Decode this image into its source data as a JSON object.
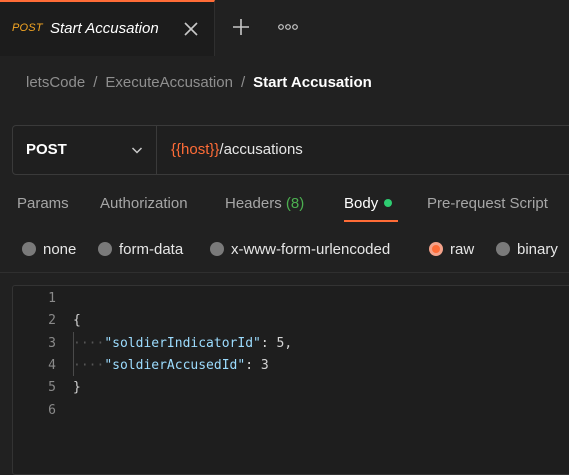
{
  "tab": {
    "method": "POST",
    "name": "Start Accusation"
  },
  "breadcrumb": {
    "items": [
      "letsCode",
      "ExecuteAccusation"
    ],
    "separator": "/",
    "current": "Start Accusation"
  },
  "request": {
    "method": "POST",
    "url_var": "{{host}}",
    "url_path": "/accusations"
  },
  "request_tabs": [
    {
      "label": "Params"
    },
    {
      "label": "Authorization"
    },
    {
      "label": "Headers",
      "count": "(8)"
    },
    {
      "label": "Body",
      "active": true
    },
    {
      "label": "Pre-request Script"
    }
  ],
  "body_types": [
    {
      "label": "none",
      "selected": false
    },
    {
      "label": "form-data",
      "selected": false
    },
    {
      "label": "x-www-form-urlencoded",
      "selected": false
    },
    {
      "label": "raw",
      "selected": true
    },
    {
      "label": "binary",
      "selected": false
    }
  ],
  "editor": {
    "line_numbers": [
      "1",
      "2",
      "3",
      "4",
      "5",
      "6"
    ],
    "open_brace": "{",
    "close_brace": "}",
    "indent_dots": "····",
    "fields": [
      {
        "key": "\"soldierIndicatorId\"",
        "sep": ": ",
        "value": "5",
        "trail": ","
      },
      {
        "key": "\"soldierAccusedId\"",
        "sep": ": ",
        "value": "3",
        "trail": ""
      }
    ]
  },
  "colors": {
    "accent": "#ff6c37",
    "method_tab": "#f5a623",
    "headers_count": "#4caf50",
    "body_dot": "#2ecc71",
    "json_key": "#9cdcfe"
  },
  "icons": {
    "tab_close": "close-icon",
    "new_tab": "plus-icon",
    "more": "more-horizontal-icon",
    "method_dropdown": "chevron-down-icon"
  }
}
